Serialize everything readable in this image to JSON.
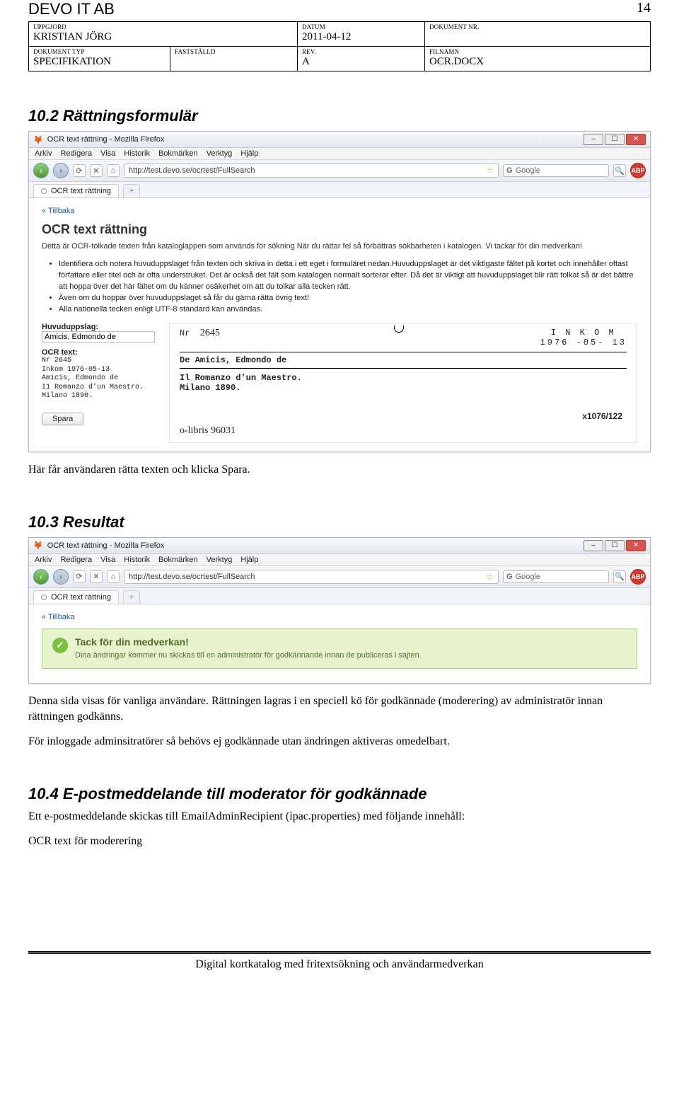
{
  "page_number_top": "14",
  "company": "DEVO IT AB",
  "docbox": {
    "row1": {
      "author_label": "UPPGJORD",
      "author": "KRISTIAN JÖRG",
      "date_label": "DATUM",
      "date": "2011-04-12",
      "docnum_label": "DOKUMENT NR."
    },
    "row2": {
      "doctype_label": "DOKUMENT TYP",
      "doctype": "SPECIFIKATION",
      "sign_label": "FASTSTÄLLD",
      "rev_label": "REV.",
      "rev": "A",
      "file_label": "FILNAMN",
      "file": "OCR.DOCX"
    }
  },
  "sections": {
    "s10_2": "10.2  Rättningsformulär",
    "s10_2_body": "Här får användaren rätta texten och klicka Spara.",
    "s10_3": "10.3 Resultat",
    "s10_3_body1": "Denna sida visas för vanliga användare. Rättningen lagras i en speciell kö för godkännade (moderering) av administratör  innan rättningen godkänns.",
    "s10_3_body2": "För inloggade adminsitratörer så behövs ej godkännade utan ändringen aktiveras omedelbart.",
    "s10_4": "10.4 E-postmeddelande till moderator för godkännade",
    "s10_4_body": "Ett e-postmeddelande skickas till EmailAdminRecipient (ipac.properties) med följande innehåll:",
    "s10_4_sub": "OCR text för moderering"
  },
  "shot1": {
    "window_title": "OCR text rättning - Mozilla Firefox",
    "menu": [
      "Arkiv",
      "Redigera",
      "Visa",
      "Historik",
      "Bokmärken",
      "Verktyg",
      "Hjälp"
    ],
    "url": "http://test.devo.se/ocrtest/FullSearch",
    "search_placeholder": "Google",
    "tab": "OCR text rättning",
    "backlink": "« Tillbaka",
    "heading": "OCR text rättning",
    "intro": "Detta är OCR-tolkade texten från kataloglappen som används för sökning När du rättar fel så förbättras sökbarheten i katalogen. Vi tackar för din medverkan!",
    "bullets": [
      "Identifiera och notera huvuduppslaget från texten och skriva in detta i ett eget i formuläret nedan.Huvuduppslaget är det viktigaste fältet på kortet och innehåller oftast författare eller titel och är ofta understruket. Det är också det fält som katalogen normalt sorterar efter. Då det är viktigt att huvuduppslaget blir rätt tolkat så är det bättre att hoppa över det här fältet om du känner osäkerhet om att du tolkar alla tecken rätt.",
      "Även om du hoppar över huvuduppslaget så får du gärna rätta övrig text!",
      "Alla nationella tecken enligt UTF-8 standard kan användas."
    ],
    "left": {
      "hu_label": "Huvuduppslag:",
      "hu_value": "Amicis, Edmondo de",
      "ocr_label": "OCR text:",
      "ocr_text": "Nr 2645\nInkom 1976-05-13\nAmicis, Edmondo de\nI1 Romanzo d'un Maestro.\nMilano 1890."
    },
    "card": {
      "nr_label": "Nr",
      "nr_value": "2645",
      "inkom_label": "I N K O M",
      "inkom_date": "1976 -05- 13",
      "author": "De Amicis, Edmondo de",
      "title": "Il Romanzo d'un Maestro.",
      "place": "Milano 1890.",
      "pager": "x1076/122",
      "handwritten": "o-libris 96031"
    },
    "save_label": "Spara"
  },
  "shot2": {
    "window_title": "OCR text rättning - Mozilla Firefox",
    "menu": [
      "Arkiv",
      "Redigera",
      "Visa",
      "Historik",
      "Bokmärken",
      "Verktyg",
      "Hjälp"
    ],
    "url": "http://test.devo.se/ocrtest/FullSearch",
    "search_placeholder": "Google",
    "tab": "OCR text rättning",
    "backlink": "« Tillbaka",
    "result_heading": "Tack för din medverkan!",
    "result_body": "Dina ändringar kommer nu skickas till en administratör för godkännande innan de publiceras i sajten."
  },
  "footer": "Digital kortkatalog med fritextsökning och användarmedverkan"
}
